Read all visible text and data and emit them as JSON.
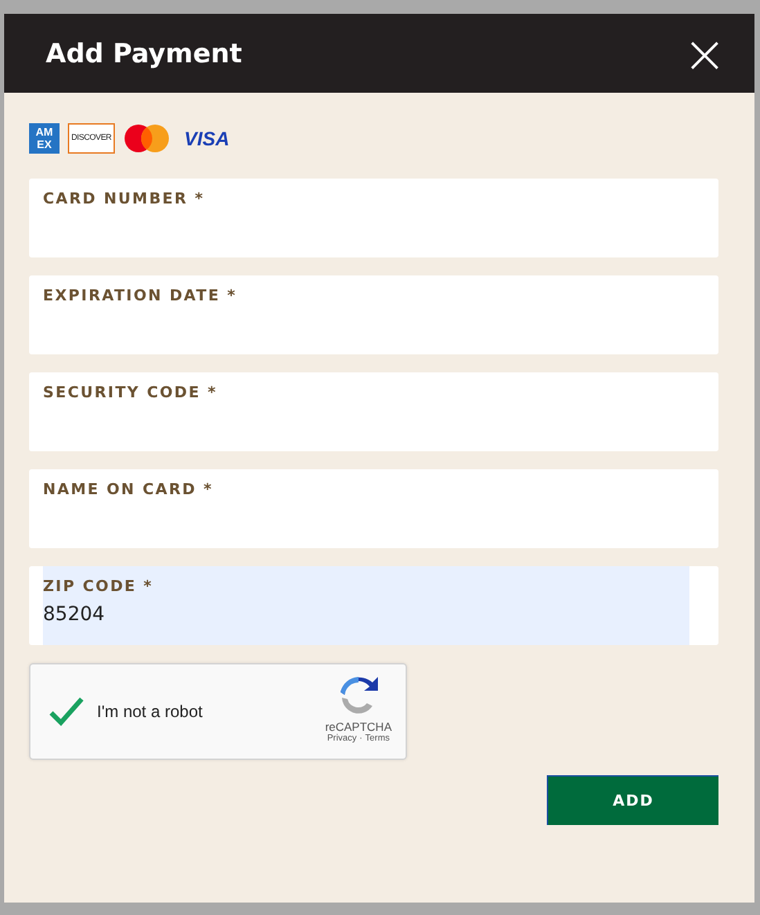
{
  "dialog": {
    "title": "Add Payment",
    "close": "×"
  },
  "card_logos": [
    {
      "kind": "amex",
      "lines": [
        "AM",
        "EX"
      ]
    },
    {
      "kind": "discover",
      "lines": [
        "DISCOVER"
      ]
    },
    {
      "kind": "mastercard"
    },
    {
      "kind": "visa",
      "lines": [
        "VISA"
      ]
    }
  ],
  "fields": [
    {
      "label": "CARD NUMBER *",
      "autofilled": false
    },
    {
      "label": "EXPIRATION DATE *",
      "autofilled": false
    },
    {
      "label": "SECURITY CODE *",
      "autofilled": false
    },
    {
      "label": "NAME ON CARD *",
      "autofilled": false
    },
    {
      "label": "ZIP CODE *",
      "value": "85204",
      "autofilled": true
    }
  ],
  "captcha": {
    "label": "I'm not a robot",
    "checked": true,
    "brand": "reCAPTCHA",
    "links": [
      "Privacy",
      "Terms"
    ],
    "separator": "·"
  },
  "buttons": [
    "ADD"
  ]
}
